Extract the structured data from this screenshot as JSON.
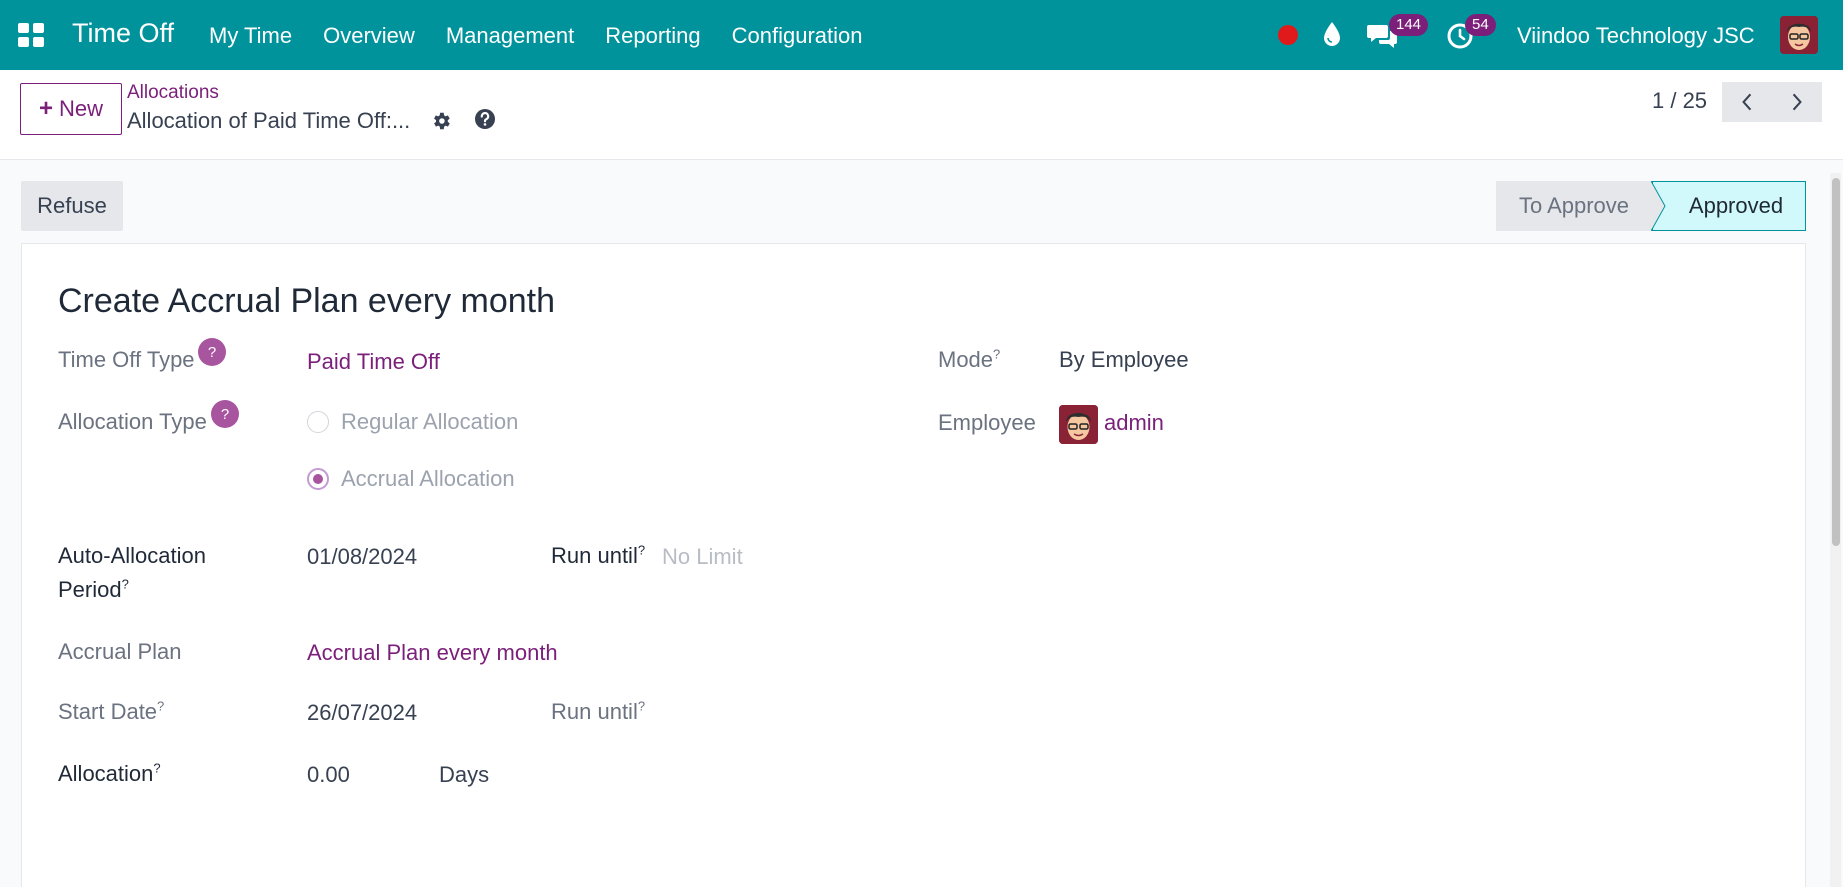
{
  "navbar": {
    "app_title": "Time Off",
    "menu": [
      "My Time",
      "Overview",
      "Management",
      "Reporting",
      "Configuration"
    ],
    "messages_count": "144",
    "activities_count": "54",
    "company": "Viindoo Technology JSC",
    "accent_color": "#00939c"
  },
  "control_panel": {
    "new_label": "New",
    "breadcrumb": "Allocations",
    "record_title": "Allocation of Paid Time Off:...",
    "pager": "1 / 25"
  },
  "status_bar": {
    "refuse_label": "Refuse",
    "stages": [
      "To Approve",
      "Approved"
    ],
    "current_stage": "Approved"
  },
  "form": {
    "title": "Create Accrual Plan every month",
    "time_off_type_label": "Time Off Type",
    "time_off_type_value": "Paid Time Off",
    "allocation_type_label": "Allocation Type",
    "allocation_type_options": [
      "Regular Allocation",
      "Accrual Allocation"
    ],
    "allocation_type_selected": "Accrual Allocation",
    "help_mark": "?",
    "mode_label": "Mode",
    "mode_value": "By Employee",
    "employee_label": "Employee",
    "employee_value": "admin",
    "auto_alloc_label_line1": "Auto-Allocation",
    "auto_alloc_label_line2": "Period",
    "auto_alloc_value": "01/08/2024",
    "run_until_label": "Run until",
    "run_until_placeholder": "No Limit",
    "accrual_plan_label": "Accrual Plan",
    "accrual_plan_value": "Accrual Plan every month",
    "start_date_label": "Start Date",
    "start_date_value": "26/07/2024",
    "run_until_label_2": "Run until",
    "allocation_label": "Allocation",
    "allocation_value": "0.00",
    "allocation_unit": "Days"
  }
}
